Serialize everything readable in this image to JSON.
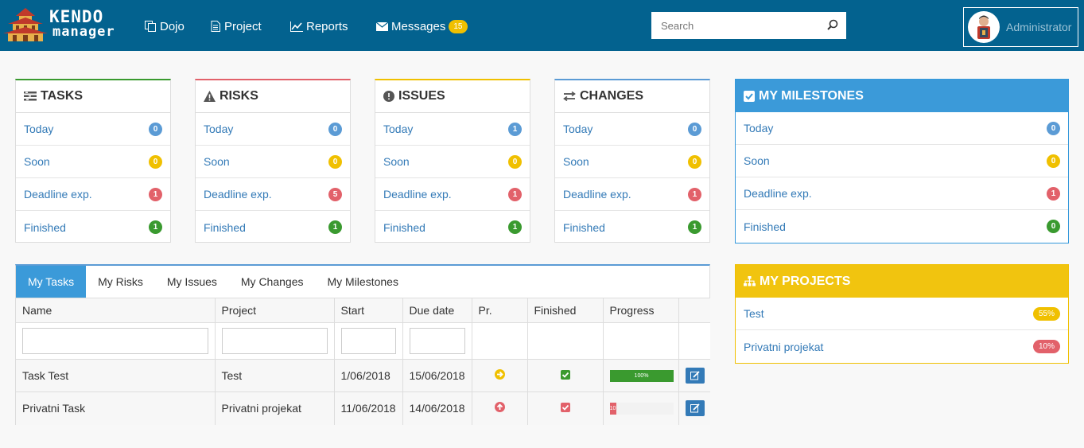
{
  "nav": {
    "logo_line1": "KENDO",
    "logo_line2": "manager",
    "items": [
      {
        "label": "Dojo",
        "icon": "copy-icon"
      },
      {
        "label": "Project",
        "icon": "file-icon"
      },
      {
        "label": "Reports",
        "icon": "line-chart-icon"
      },
      {
        "label": "Messages",
        "icon": "envelope-icon",
        "badge": "15"
      }
    ],
    "search_placeholder": "Search",
    "user": "Administrator"
  },
  "panels": [
    {
      "title": "TASKS",
      "icon": "tasks-icon",
      "accent": "#3a9a2f",
      "rows": [
        {
          "label": "Today",
          "count": "0",
          "color": "blue"
        },
        {
          "label": "Soon",
          "count": "0",
          "color": "yellow"
        },
        {
          "label": "Deadline exp.",
          "count": "1",
          "color": "red"
        },
        {
          "label": "Finished",
          "count": "1",
          "color": "green"
        }
      ]
    },
    {
      "title": "RISKS",
      "icon": "warning-icon",
      "accent": "#e2616a",
      "rows": [
        {
          "label": "Today",
          "count": "0",
          "color": "blue"
        },
        {
          "label": "Soon",
          "count": "0",
          "color": "yellow"
        },
        {
          "label": "Deadline exp.",
          "count": "5",
          "color": "red"
        },
        {
          "label": "Finished",
          "count": "1",
          "color": "green"
        }
      ]
    },
    {
      "title": "ISSUES",
      "icon": "exclamation-circle-icon",
      "accent": "#f0c000",
      "rows": [
        {
          "label": "Today",
          "count": "1",
          "color": "blue"
        },
        {
          "label": "Soon",
          "count": "0",
          "color": "yellow"
        },
        {
          "label": "Deadline exp.",
          "count": "1",
          "color": "red"
        },
        {
          "label": "Finished",
          "count": "1",
          "color": "green"
        }
      ]
    },
    {
      "title": "CHANGES",
      "icon": "exchange-icon",
      "accent": "#5b9bd5",
      "rows": [
        {
          "label": "Today",
          "count": "0",
          "color": "blue"
        },
        {
          "label": "Soon",
          "count": "0",
          "color": "yellow"
        },
        {
          "label": "Deadline exp.",
          "count": "1",
          "color": "red"
        },
        {
          "label": "Finished",
          "count": "1",
          "color": "green"
        }
      ]
    }
  ],
  "milestones": {
    "title": "MY MILESTONES",
    "icon": "check-square-icon",
    "rows": [
      {
        "label": "Today",
        "count": "0",
        "color": "blue"
      },
      {
        "label": "Soon",
        "count": "0",
        "color": "yellow"
      },
      {
        "label": "Deadline exp.",
        "count": "1",
        "color": "red"
      },
      {
        "label": "Finished",
        "count": "0",
        "color": "green"
      }
    ]
  },
  "projects": {
    "title": "MY PROJECTS",
    "icon": "sitemap-icon",
    "rows": [
      {
        "label": "Test",
        "pct": "55%",
        "color": "#f0c000"
      },
      {
        "label": "Privatni projekat",
        "pct": "10%",
        "color": "#e2616a"
      }
    ]
  },
  "tabs": [
    "My Tasks",
    "My Risks",
    "My Issues",
    "My Changes",
    "My Milestones"
  ],
  "table": {
    "columns": [
      "Name",
      "Project",
      "Start",
      "Due date",
      "Pr.",
      "Finished",
      "Progress",
      ""
    ],
    "rows": [
      {
        "name": "Task Test",
        "project": "Test",
        "start": "1/06/2018",
        "due": "15/06/2018",
        "priority": "arrow-right",
        "priority_color": "#f0c000",
        "finished_color": "#3a9a2f",
        "progress": 100,
        "progress_label": "100%",
        "progress_color": "#3a9a2f"
      },
      {
        "name": "Privatni Task",
        "project": "Privatni projekat",
        "start": "11/06/2018",
        "due": "14/06/2018",
        "priority": "arrow-up",
        "priority_color": "#e2616a",
        "finished_color": "#e2616a",
        "progress": 10,
        "progress_label": "10",
        "progress_color": "#e2616a"
      }
    ]
  }
}
